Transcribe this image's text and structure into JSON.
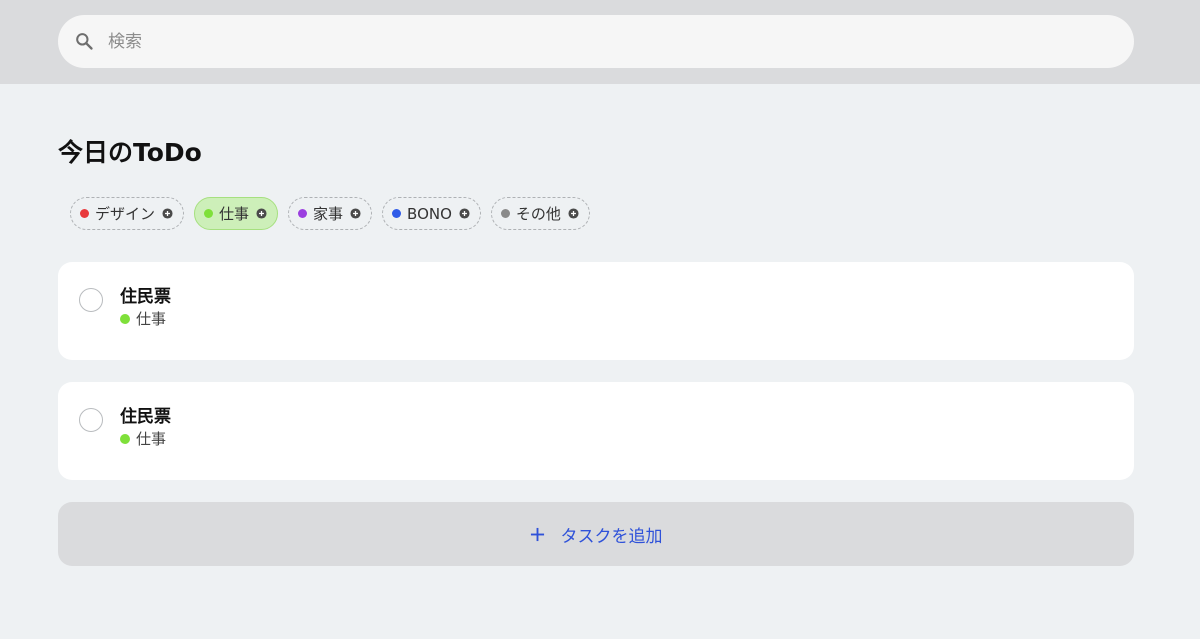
{
  "search": {
    "placeholder": "検索",
    "value": ""
  },
  "page": {
    "title": "今日のToDo"
  },
  "tags": [
    {
      "label": "デザイン",
      "color": "#E8393C",
      "active": false
    },
    {
      "label": "仕事",
      "color": "#7FE03A",
      "active": true
    },
    {
      "label": "家事",
      "color": "#9B3FE0",
      "active": false
    },
    {
      "label": "BONO",
      "color": "#2F5BE8",
      "active": false
    },
    {
      "label": "その他",
      "color": "#8A8A8A",
      "active": false
    }
  ],
  "tasks": [
    {
      "title": "住民票",
      "category": "仕事",
      "category_color": "#7FE03A",
      "done": false
    },
    {
      "title": "住民票",
      "category": "仕事",
      "category_color": "#7FE03A",
      "done": false
    }
  ],
  "add_task": {
    "label": "タスクを追加",
    "icon": "plus-icon",
    "color": "#2F52D9"
  },
  "icons": {
    "search": "search-icon",
    "tag_add": "plus-circle-icon",
    "checkbox": "circle-checkbox-icon"
  }
}
